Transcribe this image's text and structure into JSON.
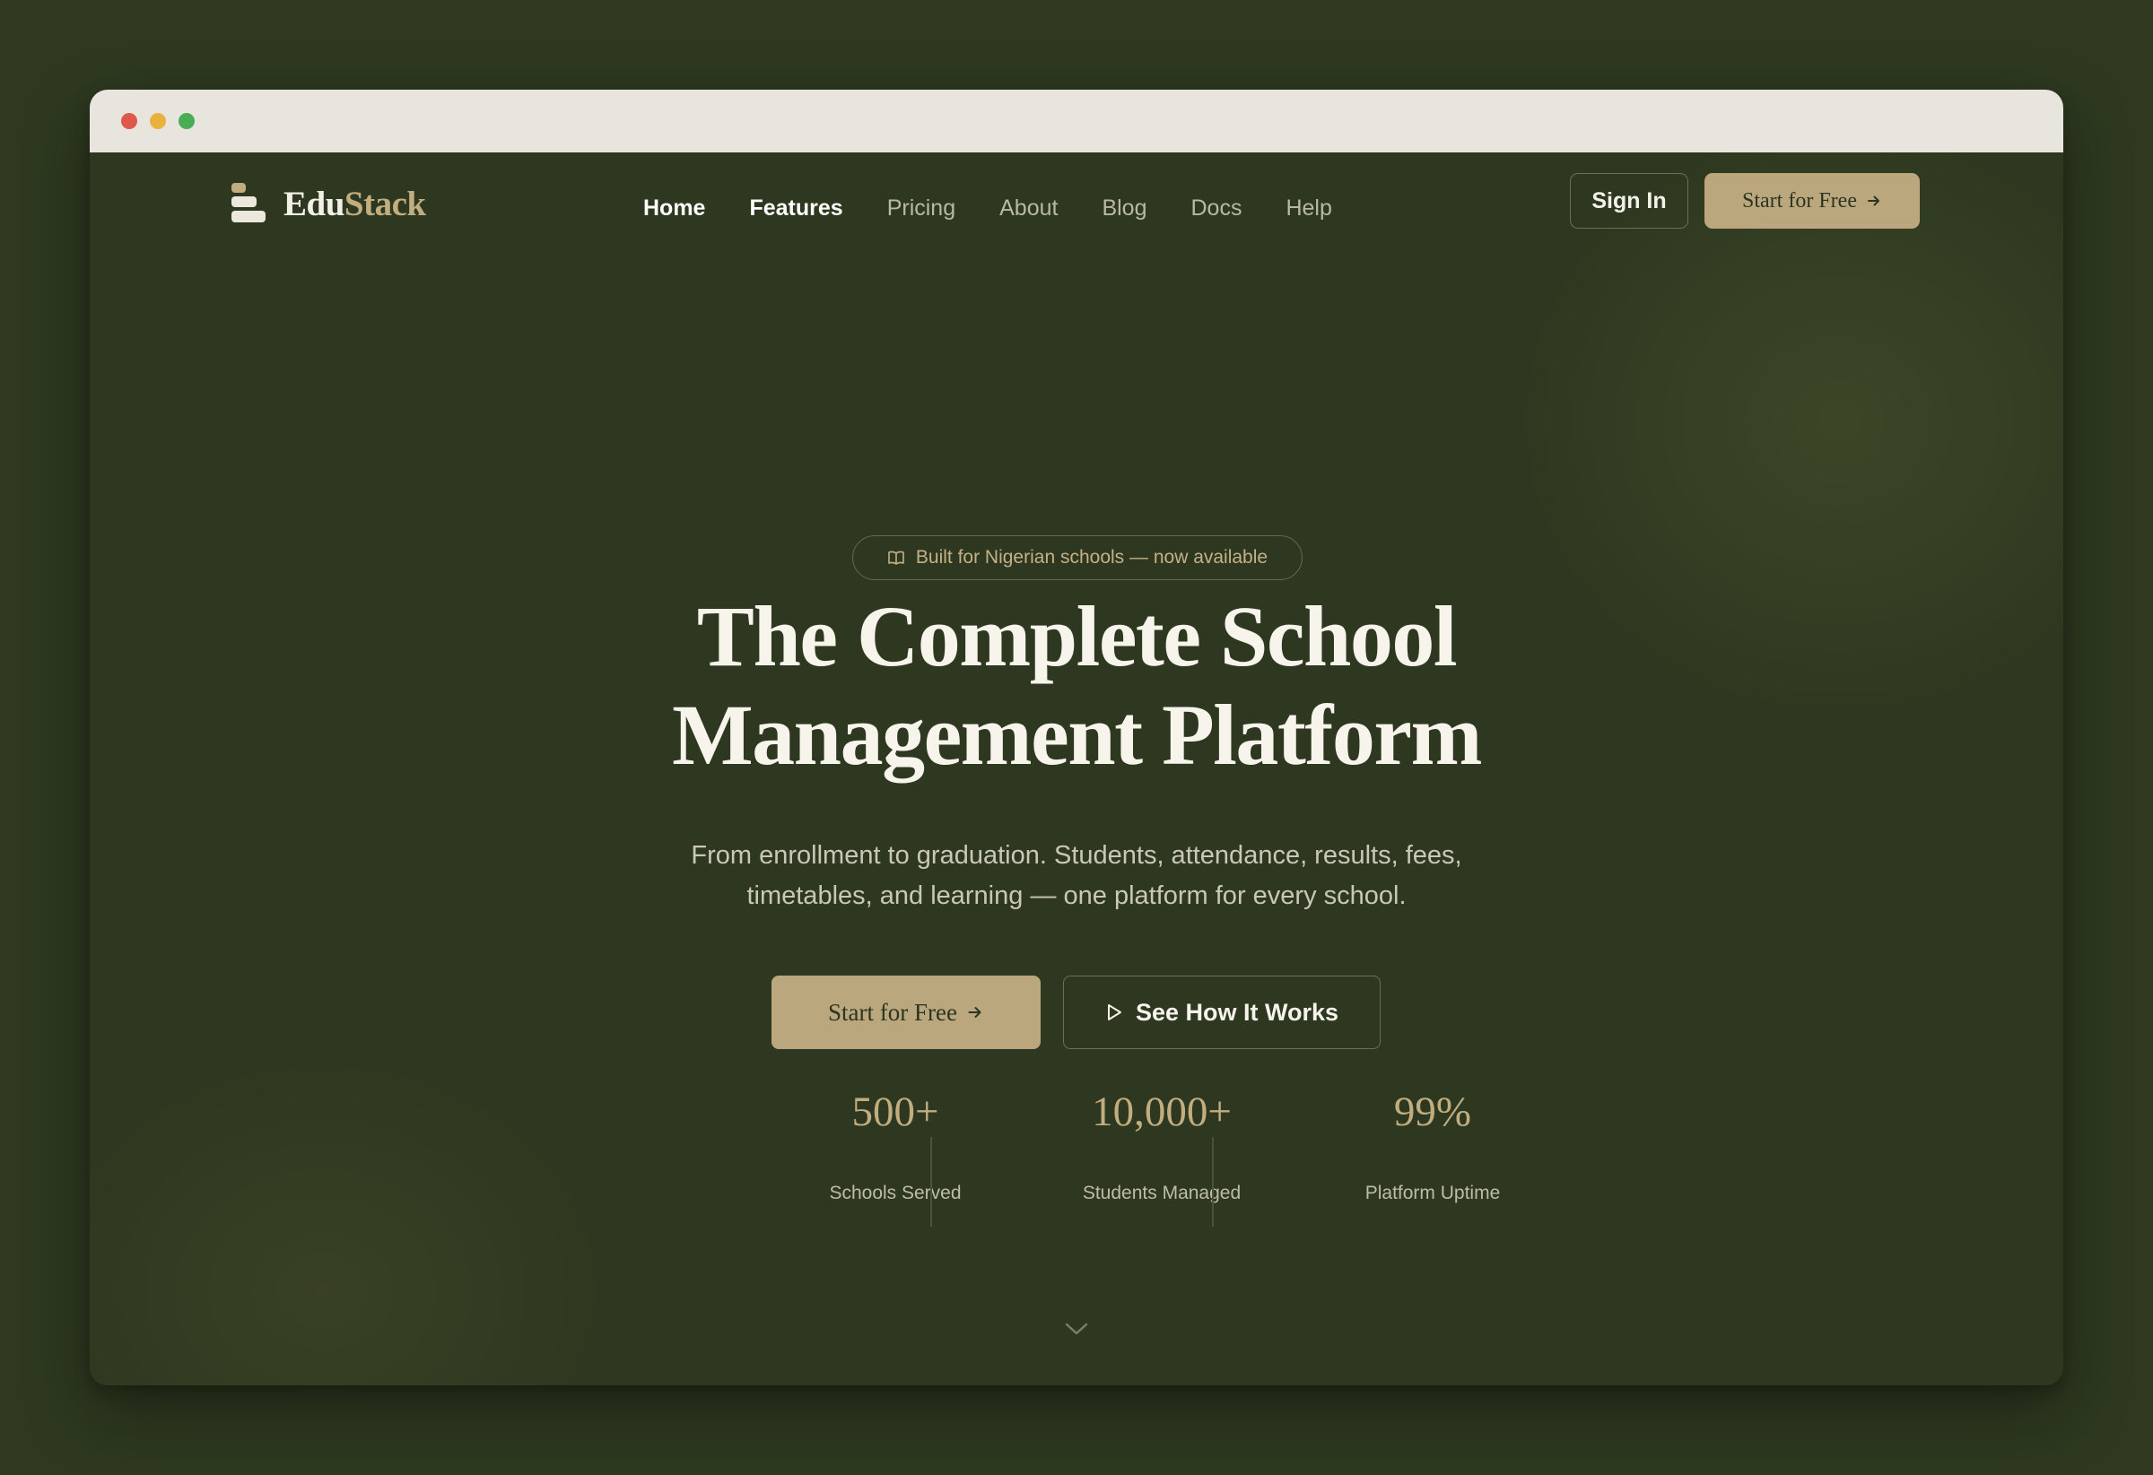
{
  "window": {
    "controls": {
      "close_color": "#e0584b",
      "minimize_color": "#e8b23c",
      "zoom_color": "#49ad55"
    }
  },
  "brand": {
    "name_part1": "Edu",
    "name_part2": "Stack",
    "accent_color": "#c2ad7f",
    "icon": "stacked-books-logo"
  },
  "nav": {
    "items": [
      {
        "label": "Home",
        "active": true
      },
      {
        "label": "Features",
        "active": true
      },
      {
        "label": "Pricing",
        "active": false
      },
      {
        "label": "About",
        "active": false
      },
      {
        "label": "Blog",
        "active": false
      },
      {
        "label": "Docs",
        "active": false
      },
      {
        "label": "Help",
        "active": false
      }
    ],
    "sign_in_label": "Sign In",
    "start_free_label": "Start for Free"
  },
  "hero": {
    "badge_icon": "book-open-icon",
    "badge_text": "Built for Nigerian schools — now available",
    "headline_line1": "The Complete School",
    "headline_line2": "Management Platform",
    "subhead_line1": "From enrollment to graduation. Students, attendance, results, fees,",
    "subhead_line2": "timetables, and learning — one platform for every school.",
    "primary_cta": "Start for Free",
    "secondary_cta": "See How It Works",
    "secondary_icon": "play-icon"
  },
  "stats": [
    {
      "value": "500+",
      "label": "Schools Served"
    },
    {
      "value": "10,000+",
      "label": "Students Managed"
    },
    {
      "value": "99%",
      "label": "Platform Uptime"
    }
  ],
  "scroll_indicator_icon": "chevron-down-icon"
}
